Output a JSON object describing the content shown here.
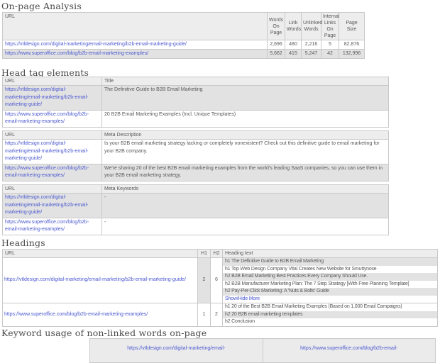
{
  "urls": {
    "vtldesign": "https://vtldesign.com/digital-marketing/email-marketing/b2b-email-marketing-guide/",
    "superoffice": "https://www.superoffice.com/blog/b2b-email-marketing-examples/"
  },
  "colors": {
    "link": "#4a58d0",
    "row_stripe": "#e2e2e2",
    "header_bg": "#ededed",
    "border": "#c9c9c9"
  },
  "on_page": {
    "title": "On-page Analysis",
    "columns": {
      "url": "URL",
      "words_on_page": "Words On Page",
      "link_words": "Link Words",
      "unlinked_words": "Unlinked Words",
      "internal_links": "Internal Links On Page",
      "page_size": "Page Size"
    },
    "rows": [
      {
        "words_on_page": "2,696",
        "link_words": "480",
        "unlinked_words": "2,216",
        "internal_links": "5",
        "page_size": "82,876"
      },
      {
        "words_on_page": "5,662",
        "link_words": "415",
        "unlinked_words": "5,247",
        "internal_links": "42",
        "page_size": "132,996"
      }
    ]
  },
  "head_tags": {
    "title": "Head tag elements",
    "title_table": {
      "url_header": "URL",
      "value_header": "Title",
      "values": [
        "The Definitive Guide to B2B Email Marketing",
        "20 B2B Email Marketing Examples (Incl. Unique Templates)"
      ]
    },
    "meta_description_table": {
      "url_header": "URL",
      "value_header": "Meta Description",
      "values": [
        "Is your B2B email marketing strategy lacking or completely nonexistent? Check out this definitive guide to email marketing for your B2B company.",
        "We're sharing 20 of the best B2B email marketing examples from the world's leading SaaS companies, so you can use them in your B2B email marketing strategy."
      ]
    },
    "meta_keywords_table": {
      "url_header": "URL",
      "value_header": "Meta Keywords",
      "values": [
        "-",
        "-"
      ]
    }
  },
  "headings": {
    "title": "Headings",
    "columns": {
      "url": "URL",
      "h1": "H1",
      "h2": "H2",
      "heading_text": "Heading text"
    },
    "rows": [
      {
        "h1_count": "2",
        "h2_count": "6",
        "lines": [
          "h1 The Definitive Guide to B2B Email Marketing",
          "h1 Top Web Design Company Vital Creates New Website for Smuttynose",
          "h2 B2B Email Marketing Best Practices Every Company Should Use.",
          "h2 B2B Manufacturer Marketing Plan: The 7 Step Strategy [With Free Planning Template]",
          "h2 Pay-Per-Click Marketing: A 'Nuts & Bolts' Guide"
        ],
        "show_more": "Show/Hide More"
      },
      {
        "h1_count": "1",
        "h2_count": "2",
        "lines": [
          "h1 20 of the Best B2B Email Marketing Examples (Based on 1,000 Email Campaigns)",
          "h2 20 B2B email marketing templates",
          "h2 Conclusion"
        ]
      }
    ]
  },
  "keyword_usage": {
    "title": "Keyword usage of non-linked words on-page",
    "columns": [
      "https://vtldesign.com/digital-marketing/email-",
      "https://www.superoffice.com/blog/b2b-email-"
    ]
  }
}
